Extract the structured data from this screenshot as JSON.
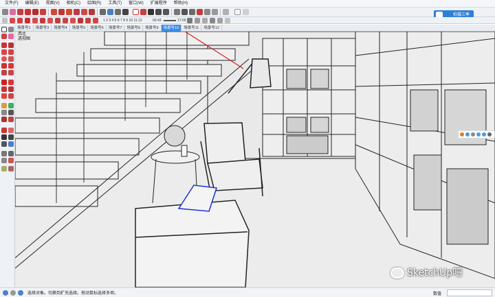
{
  "menu": [
    "文件(F)",
    "编辑(E)",
    "视图(V)",
    "相机(C)",
    "绘图(R)",
    "工具(T)",
    "窗口(W)",
    "扩展程序",
    "帮助(H)"
  ],
  "brand_button": "拍摄三季",
  "scene_tabs": [
    "场景号1",
    "场景号3",
    "场景号4",
    "场景号5",
    "场景号6",
    "场景号7",
    "场景号8",
    "场景号9",
    "场景号10",
    "场景号11",
    "场景号12"
  ],
  "active_scene_index": 8,
  "shadow_slider_months": "1 2 3 4 5 6 7 8 9 10 11 12",
  "shadow_time_start": "06:43",
  "shadow_time_end": "17:00",
  "viewport": {
    "label_top": "西北",
    "label_view": "透视图"
  },
  "watermark": "SketchUp吧",
  "status": {
    "message": "选择对象。切换到扩充选择。拖动鼠标选择多项。",
    "vcb_label": "数值",
    "vcb_value": ""
  },
  "colors": {
    "accent": "#3d8ae0",
    "selection": "#1a2fd6",
    "annotation_line": "#d42020",
    "viewport_bg": "#ececec"
  }
}
